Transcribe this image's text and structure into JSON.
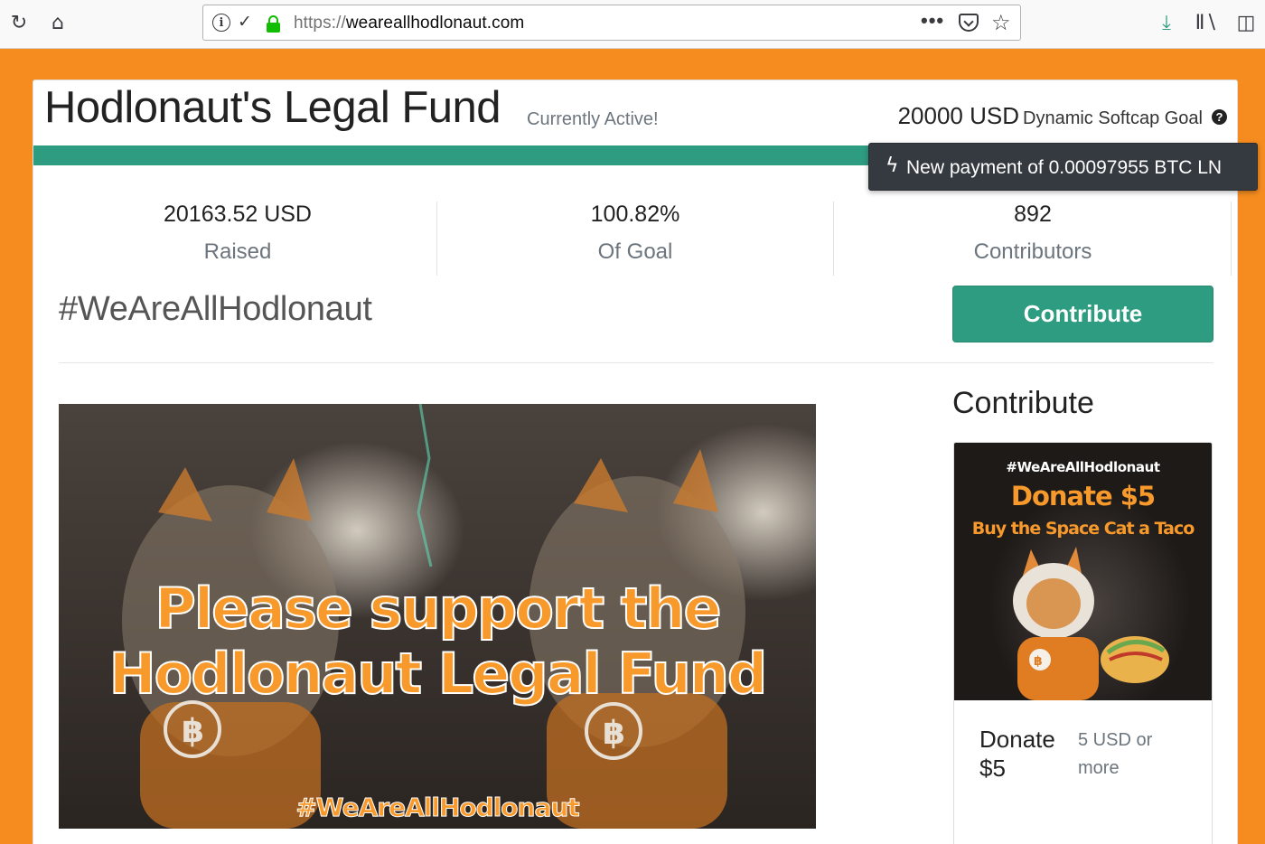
{
  "browser": {
    "url_protocol": "https://",
    "url_host": "weareallhodlonaut.com"
  },
  "header": {
    "title": "Hodlonaut's Legal Fund",
    "status": "Currently Active!",
    "goal_amount": "20000 USD",
    "goal_label": "Dynamic Softcap Goal",
    "help_symbol": "?"
  },
  "progress": {
    "fraction": 1.0
  },
  "stats": [
    {
      "value": "20163.52 USD",
      "label": "Raised"
    },
    {
      "value": "100.82%",
      "label": "Of Goal"
    },
    {
      "value": "892",
      "label": "Contributors"
    }
  ],
  "hashtag": "#WeAreAllHodlonaut",
  "contribute_button": "Contribute",
  "banner": {
    "line1": "Please support the",
    "line2": "Hodlonaut Legal Fund",
    "tag": "#WeAreAllHodlonaut"
  },
  "sidebar": {
    "heading": "Contribute",
    "perk": {
      "image_tag": "#WeAreAllHodlonaut",
      "image_donate": "Donate $5",
      "image_subtitle": "Buy the Space Cat a Taco",
      "title": "Donate $5",
      "price": "5 USD or more"
    }
  },
  "notification": {
    "icon": "lightning-icon",
    "text": "New payment of 0.00097955 BTC LN"
  },
  "colors": {
    "page_background": "#f68c1f",
    "accent_green": "#2e9c80",
    "banner_orange": "#f89a2b",
    "notification_bg": "#343a40"
  }
}
